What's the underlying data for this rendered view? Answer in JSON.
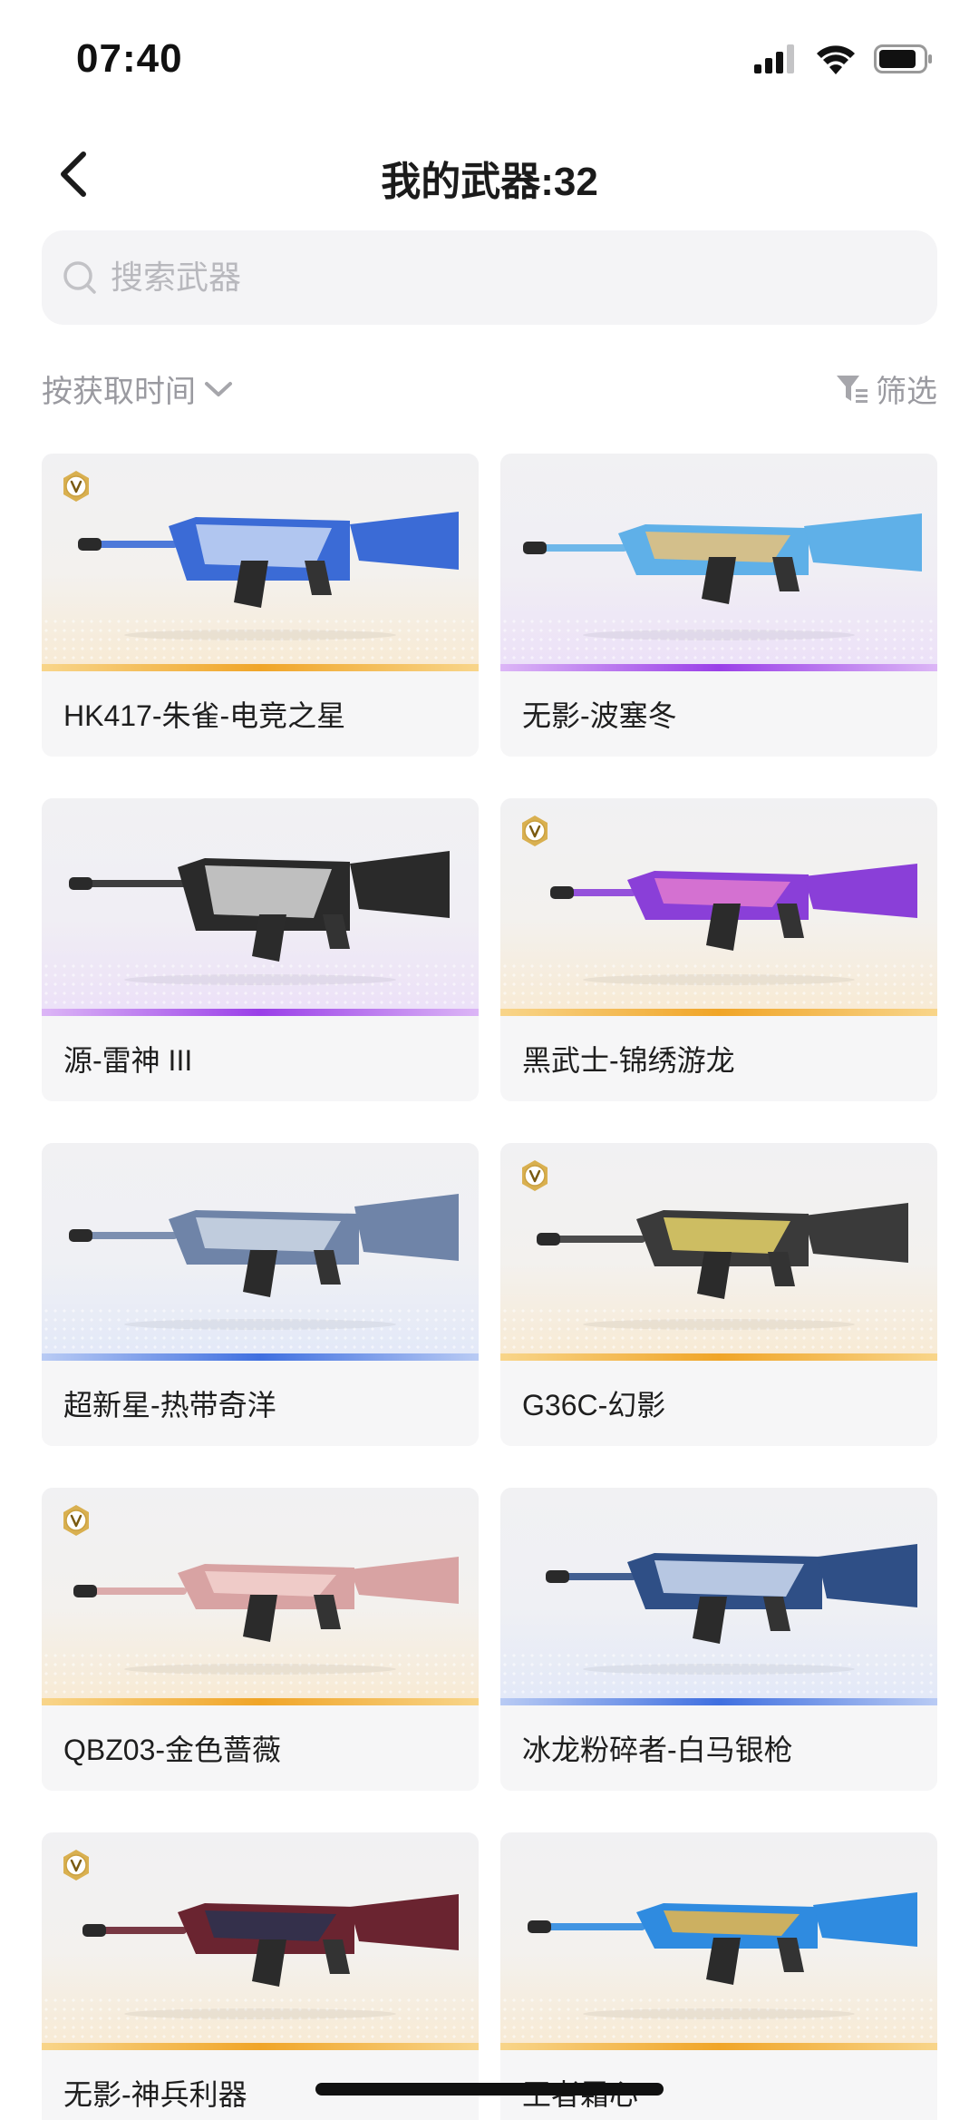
{
  "status_bar": {
    "time": "07:40"
  },
  "nav": {
    "title": "我的武器:32"
  },
  "search": {
    "placeholder": "搜索武器"
  },
  "toolbar": {
    "sort_label": "按获取时间",
    "filter_label": "筛选"
  },
  "weapons": [
    {
      "name": "HK417-朱雀-电竞之星",
      "rarity": "gold",
      "badge": true
    },
    {
      "name": "无影-波塞冬",
      "rarity": "purple",
      "badge": false
    },
    {
      "name": "源-雷神 III",
      "rarity": "purple",
      "badge": false
    },
    {
      "name": "黑武士-锦绣游龙",
      "rarity": "gold",
      "badge": true
    },
    {
      "name": "超新星-热带奇洋",
      "rarity": "blue",
      "badge": false
    },
    {
      "name": "G36C-幻影",
      "rarity": "gold",
      "badge": true
    },
    {
      "name": "QBZ03-金色蔷薇",
      "rarity": "gold",
      "badge": true
    },
    {
      "name": "冰龙粉碎者-白马银枪",
      "rarity": "blue",
      "badge": false
    },
    {
      "name": "无影-神兵利器",
      "rarity": "gold",
      "badge": true
    },
    {
      "name": "王者霜心",
      "rarity": "gold",
      "badge": false
    }
  ],
  "colors": {
    "gold": "#f0a528",
    "purple": "#9a3fe8",
    "blue": "#3f6fe0",
    "text_secondary": "#9a9aa0"
  }
}
